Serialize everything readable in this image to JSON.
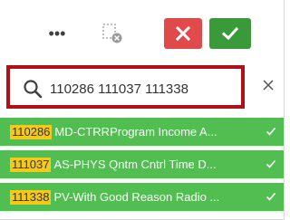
{
  "toolbar": {
    "more_label": "•••",
    "more_icon": "more-icon",
    "clear_selections_icon": "clear-selections-icon",
    "cancel_icon": "close-icon",
    "confirm_icon": "checkmark-icon",
    "cancel_color": "#e04a4a",
    "confirm_color": "#3a9a3a"
  },
  "search": {
    "value": "110286 111037 111338",
    "highlight_border_color": "#b01116",
    "search_icon": "search-icon",
    "clear_icon": "close-icon"
  },
  "results": {
    "row_color": "#52be52",
    "code_highlight_color": "#f4c91a",
    "items": [
      {
        "code": "110286",
        "label": "MD-CTRRProgram Income A...",
        "selected": true
      },
      {
        "code": "111037",
        "label": "AS-PHYS Qntm Cntrl Time D...",
        "selected": true
      },
      {
        "code": "111338",
        "label": "PV-With Good Reason Radio ...",
        "selected": true
      }
    ]
  }
}
